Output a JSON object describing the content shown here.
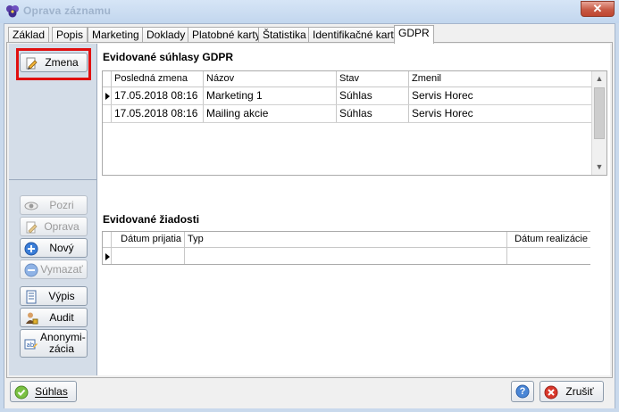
{
  "window": {
    "title": "Oprava záznamu",
    "close_label": "✕"
  },
  "tabs": [
    {
      "label": "Základ"
    },
    {
      "label": "Popis"
    },
    {
      "label": "Marketing"
    },
    {
      "label": "Doklady"
    },
    {
      "label": "Platobné karty"
    },
    {
      "label": "Štatistika"
    },
    {
      "label": "Identifikačné karty"
    },
    {
      "label": "GDPR",
      "active": true
    }
  ],
  "consents": {
    "title": "Evidované súhlasy GDPR",
    "edit_button": "Zmena",
    "columns": [
      "Posledná zmena",
      "Názov",
      "Stav",
      "Zmenil"
    ],
    "rows": [
      {
        "date": "17.05.2018 08:16",
        "name": "Marketing 1",
        "status": "Súhlas",
        "changed_by": "Servis Horec"
      },
      {
        "date": "17.05.2018 08:16",
        "name": "Mailing akcie",
        "status": "Súhlas",
        "changed_by": "Servis Horec"
      }
    ]
  },
  "requests": {
    "title": "Evidované žiadosti",
    "columns": [
      "Dátum prijatia",
      "Typ",
      "Dátum realizácie"
    ]
  },
  "side_buttons": {
    "view": "Pozri",
    "edit": "Oprava",
    "new": "Nový",
    "delete": "Vymazať",
    "report": "Výpis",
    "audit": "Audit",
    "anonymize_line1": "Anonymi-",
    "anonymize_line2": "zácia"
  },
  "footer": {
    "consent": "Súhlas",
    "help": "?",
    "cancel": "Zrušiť"
  },
  "colors": {
    "highlight": "#e01010",
    "accent": "#c9d9ec"
  }
}
